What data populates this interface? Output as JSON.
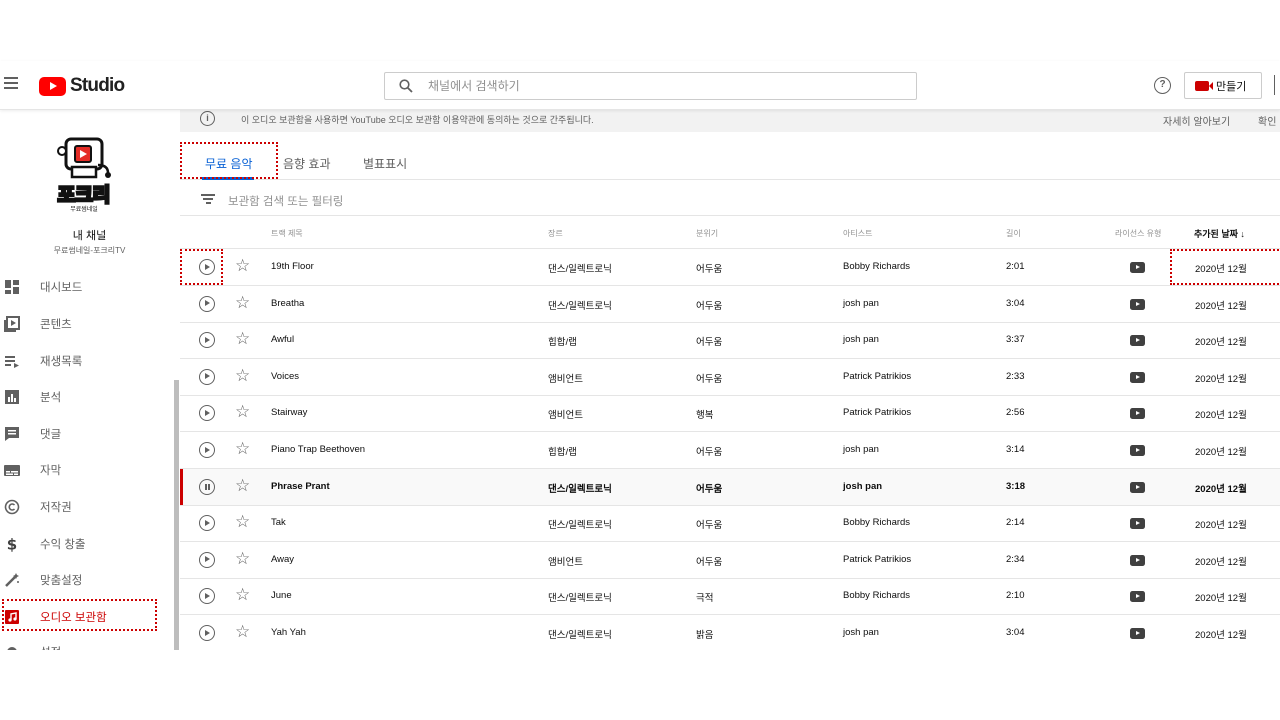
{
  "header": {
    "app_name": "Studio",
    "search_placeholder": "채널에서 검색하기",
    "help_label": "?",
    "create_label": "만들기"
  },
  "sidebar": {
    "channel_title": "내 채널",
    "channel_subtitle": "무료썸네일-포크리TV",
    "logo_text": "포크리",
    "logo_subtext": "무료썸네일",
    "items": [
      {
        "label": "대시보드",
        "icon": "dashboard-icon"
      },
      {
        "label": "콘텐츠",
        "icon": "content-icon"
      },
      {
        "label": "재생목록",
        "icon": "playlist-icon"
      },
      {
        "label": "분석",
        "icon": "analytics-icon"
      },
      {
        "label": "댓글",
        "icon": "comments-icon"
      },
      {
        "label": "자막",
        "icon": "subtitles-icon"
      },
      {
        "label": "저작권",
        "icon": "copyright-icon"
      },
      {
        "label": "수익 창출",
        "icon": "dollar-icon"
      },
      {
        "label": "맞춤설정",
        "icon": "customize-icon"
      },
      {
        "label": "오디오 보관함",
        "icon": "audio-library-icon",
        "active": true
      },
      {
        "label": "설정",
        "icon": "settings-icon"
      }
    ]
  },
  "banner": {
    "text": "이 오디오 보관함을 사용하면 YouTube 오디오 보관함 이용약관에 동의하는 것으로 간주됩니다.",
    "learn_more": "자세히 알아보기",
    "confirm": "확인"
  },
  "tabs": [
    {
      "label": "무료 음악",
      "active": true
    },
    {
      "label": "음향 효과",
      "active": false
    },
    {
      "label": "별표표시",
      "active": false
    }
  ],
  "filter": {
    "placeholder": "보관함 검색 또는 필터링"
  },
  "table": {
    "columns": {
      "title": "트랙 제목",
      "genre": "장르",
      "mood": "분위기",
      "artist": "아티스트",
      "length": "길이",
      "license": "라이선스 유형",
      "added": "추가된 날짜",
      "sort_arrow": "↓"
    },
    "rows": [
      {
        "title": "19th Floor",
        "genre": "댄스/일렉트로닉",
        "mood": "어두움",
        "artist": "Bobby Richards",
        "length": "2:01",
        "added": "2020년 12월"
      },
      {
        "title": "Breatha",
        "genre": "댄스/일렉트로닉",
        "mood": "어두움",
        "artist": "josh pan",
        "length": "3:04",
        "added": "2020년 12월"
      },
      {
        "title": "Awful",
        "genre": "힙합/랩",
        "mood": "어두움",
        "artist": "josh pan",
        "length": "3:37",
        "added": "2020년 12월"
      },
      {
        "title": "Voices",
        "genre": "앰비언트",
        "mood": "어두움",
        "artist": "Patrick Patrikios",
        "length": "2:33",
        "added": "2020년 12월"
      },
      {
        "title": "Stairway",
        "genre": "앰비언트",
        "mood": "행복",
        "artist": "Patrick Patrikios",
        "length": "2:56",
        "added": "2020년 12월"
      },
      {
        "title": "Piano Trap Beethoven",
        "genre": "힙합/랩",
        "mood": "어두움",
        "artist": "josh pan",
        "length": "3:14",
        "added": "2020년 12월"
      },
      {
        "title": "Phrase Prant",
        "genre": "댄스/일렉트로닉",
        "mood": "어두움",
        "artist": "josh pan",
        "length": "3:18",
        "added": "2020년 12월",
        "playing": true
      },
      {
        "title": "Tak",
        "genre": "댄스/일렉트로닉",
        "mood": "어두움",
        "artist": "Bobby Richards",
        "length": "2:14",
        "added": "2020년 12월"
      },
      {
        "title": "Away",
        "genre": "앰비언트",
        "mood": "어두움",
        "artist": "Patrick Patrikios",
        "length": "2:34",
        "added": "2020년 12월"
      },
      {
        "title": "June",
        "genre": "댄스/일렉트로닉",
        "mood": "극적",
        "artist": "Bobby Richards",
        "length": "2:10",
        "added": "2020년 12월"
      },
      {
        "title": "Yah Yah",
        "genre": "댄스/일렉트로닉",
        "mood": "밝음",
        "artist": "josh pan",
        "length": "3:04",
        "added": "2020년 12월"
      }
    ]
  },
  "colors": {
    "accent": "#065fd4",
    "brand": "#ff0000",
    "highlight": "#cc0000"
  }
}
